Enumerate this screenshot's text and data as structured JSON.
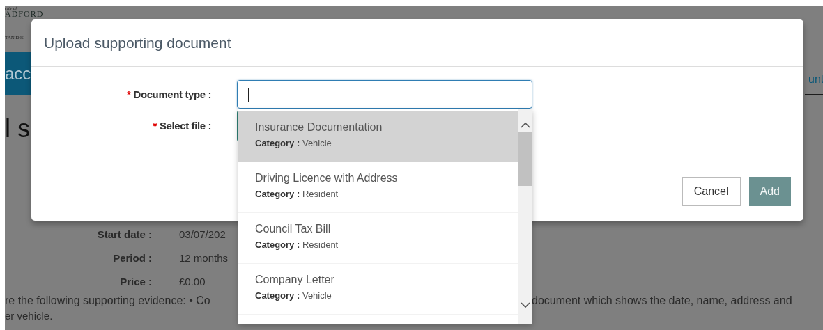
{
  "background_page": {
    "logo": {
      "line_1": "city of",
      "line_2": "ADFORD",
      "line_3": "TAN DIS"
    },
    "nav_bar": {
      "label": "acc"
    },
    "tab": {
      "label": "unt"
    },
    "heading": "l s",
    "details": [
      {
        "label": "Start date :",
        "value": "03/07/202"
      },
      {
        "label": "Period :",
        "value": "12 months"
      },
      {
        "label": "Price :",
        "value": "£0.00"
      }
    ],
    "evidence_text": {
      "left": "re the following supporting evidence: • Co",
      "right": "document which shows the date, name, address and",
      "line_2": "er vehicle."
    }
  },
  "dialog": {
    "title": "Upload supporting document",
    "fields": [
      {
        "kind": "text",
        "marker": "*",
        "label": "Document type :",
        "focused": true
      },
      {
        "kind": "file",
        "marker": "*",
        "label": "Select file :",
        "focused": false
      }
    ],
    "buttons": [
      {
        "kind": "secondary",
        "label": "Cancel"
      },
      {
        "kind": "primary",
        "label": "Add"
      }
    ]
  },
  "dropdown": {
    "options": [
      {
        "title": "Insurance Documentation",
        "category_label": "Category :",
        "category": "Vehicle",
        "selected": true
      },
      {
        "title": "Driving Licence with Address",
        "category_label": "Category :",
        "category": "Resident",
        "selected": false
      },
      {
        "title": "Council Tax Bill",
        "category_label": "Category :",
        "category": "Resident",
        "selected": false
      },
      {
        "title": "Company Letter",
        "category_label": "Category :",
        "category": "Vehicle",
        "selected": false
      }
    ]
  }
}
